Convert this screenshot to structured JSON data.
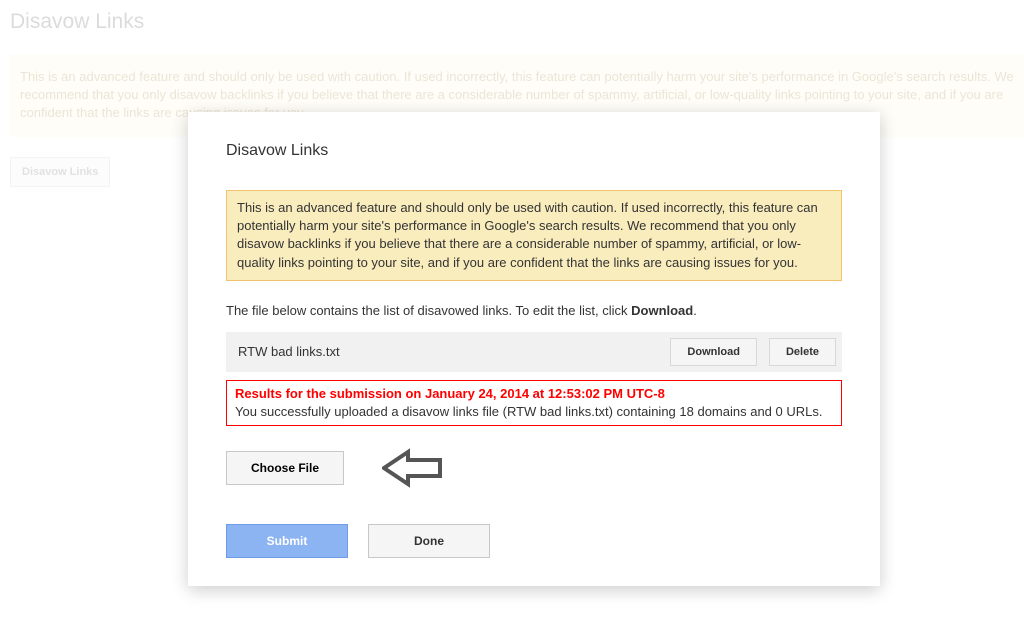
{
  "backdrop": {
    "title": "Disavow Links",
    "warning": "This is an advanced feature and should only be used with caution. If used incorrectly, this feature can potentially harm your site's performance in Google's search results. We recommend that you only disavow backlinks if you believe that there are a considerable number of spammy, artificial, or low-quality links pointing to your site, and if you are confident that the links are causing issues for you.",
    "button": "Disavow Links"
  },
  "dialog": {
    "title": "Disavow Links",
    "warning": "This is an advanced feature and should only be used with caution. If used incorrectly, this feature can potentially harm your site's performance in Google's search results. We recommend that you only disavow backlinks if you believe that there are a considerable number of spammy, artificial, or low-quality links pointing to your site, and if you are confident that the links are causing issues for you.",
    "file_desc_prefix": "The file below contains the list of disavowed links. To edit the list, click ",
    "file_desc_bold": "Download",
    "file_desc_suffix": ".",
    "file_name": "RTW bad links.txt",
    "download_label": "Download",
    "delete_label": "Delete",
    "result_title": "Results for the submission on January 24, 2014 at 12:53:02 PM UTC-8",
    "result_msg": "You successfully uploaded a disavow links file (RTW bad links.txt) containing 18 domains and 0 URLs.",
    "choose_label": "Choose File",
    "submit_label": "Submit",
    "done_label": "Done"
  }
}
